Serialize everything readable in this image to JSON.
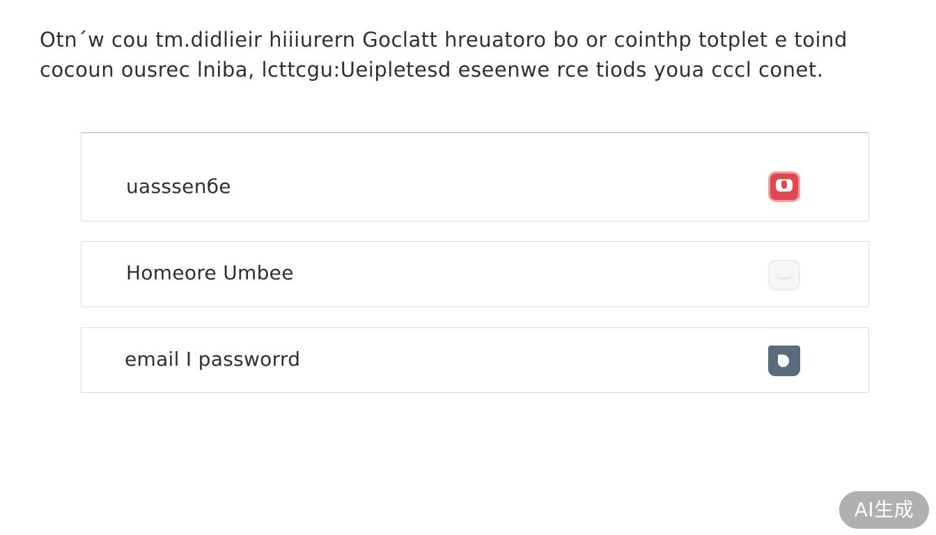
{
  "intro": {
    "line1": "Otn´w cou tm.didlieir hiiiurern Goclatt hreuatoro bo or cointhp totplet e toind",
    "line2": "cocoun ousrec lniba, lcttcgu:Ueipletesd eseenwe rce tiods  youa cccl conet."
  },
  "fields": [
    {
      "label": "uasssenбe",
      "icon": "camera-icon",
      "accent": "#e2474d"
    },
    {
      "label": "Homeore Umbee",
      "icon": "phone-icon",
      "accent": "#f6f6f6"
    },
    {
      "label": "email I passworrd",
      "icon": "document-icon",
      "accent": "#5b6b7f"
    }
  ],
  "badge": {
    "label": "AI生成"
  }
}
